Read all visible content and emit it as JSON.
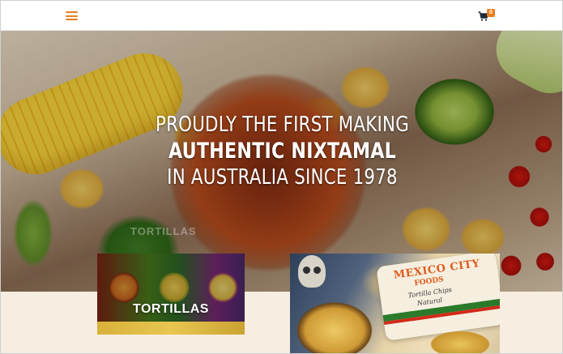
{
  "header": {
    "menu_icon": "hamburger-menu-icon",
    "cart_icon": "shopping-cart-icon",
    "cart_count": "0",
    "accent_color": "#e67e22"
  },
  "hero": {
    "line1": "PROUDLY THE FIRST MAKING",
    "line2": "AUTHENTIC NIXTAMAL",
    "line3": "IN AUSTRALIA SINCE 1978",
    "ghost_label": "TORTILLAS"
  },
  "categories": [
    {
      "label": "TORTILLAS"
    },
    {
      "label": "",
      "bag_brand": "MEXICO CITY",
      "bag_sub": "FOODS",
      "bag_product": "Tortilla Chips",
      "bag_variety": "Natural"
    }
  ]
}
